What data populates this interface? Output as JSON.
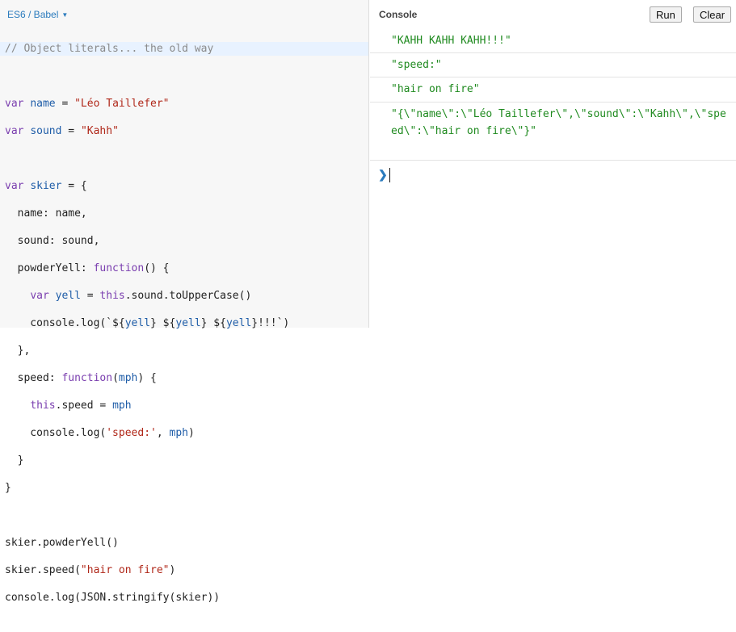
{
  "editor": {
    "language_label": "ES6 / Babel",
    "comment": "// Object literals... the old way"
  },
  "console": {
    "title": "Console",
    "run_label": "Run",
    "clear_label": "Clear",
    "outputs": [
      "\"KAHH KAHH KAHH!!!\"",
      "\"speed:\"",
      "\"hair on fire\"",
      "\"{\\\"name\\\":\\\"Léo Taillefer\\\",\\\"sound\\\":\\\"Kahh\\\",\\\"speed\\\":\\\"hair on fire\\\"}\""
    ],
    "prompt_symbol": "❯"
  },
  "colors": {
    "keyword": "#7a3eaf",
    "string": "#b0281a",
    "variable": "#1f5da8",
    "comment": "#8a8a8a",
    "console_output": "#1f8a1f",
    "accent": "#2b7bbd"
  }
}
